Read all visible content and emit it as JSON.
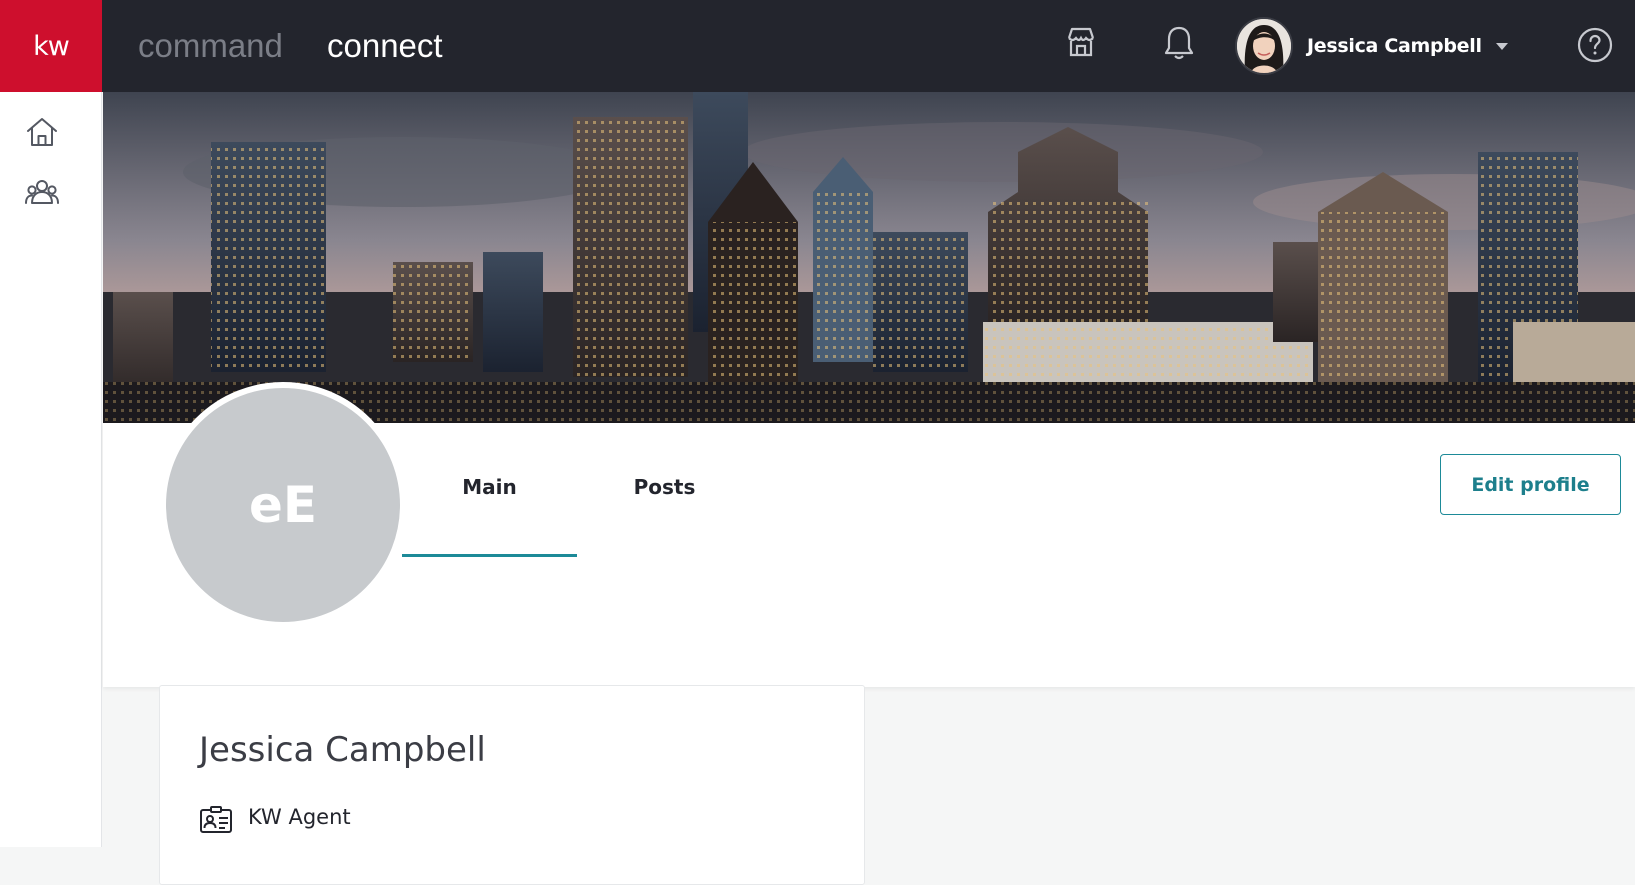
{
  "topbar": {
    "logo_text": "kw",
    "brand_command": "command",
    "brand_connect": "connect",
    "icons": [
      "store-icon",
      "bell-icon",
      "help-icon"
    ],
    "user_name": "Jessica Campbell"
  },
  "sidebar": {
    "items": [
      {
        "icon": "home-icon"
      },
      {
        "icon": "people-icon"
      }
    ]
  },
  "profile": {
    "initials": "eE",
    "tabs": [
      {
        "label": "Main",
        "active": true
      },
      {
        "label": "Posts",
        "active": false
      }
    ],
    "edit_button": "Edit profile",
    "name": "Jessica Campbell",
    "role": "KW Agent"
  },
  "colors": {
    "topbar_bg": "#23252d",
    "brand_red": "#ce0f2d",
    "accent_teal": "#1d8a98",
    "avatar_gray": "#c7cacd"
  }
}
